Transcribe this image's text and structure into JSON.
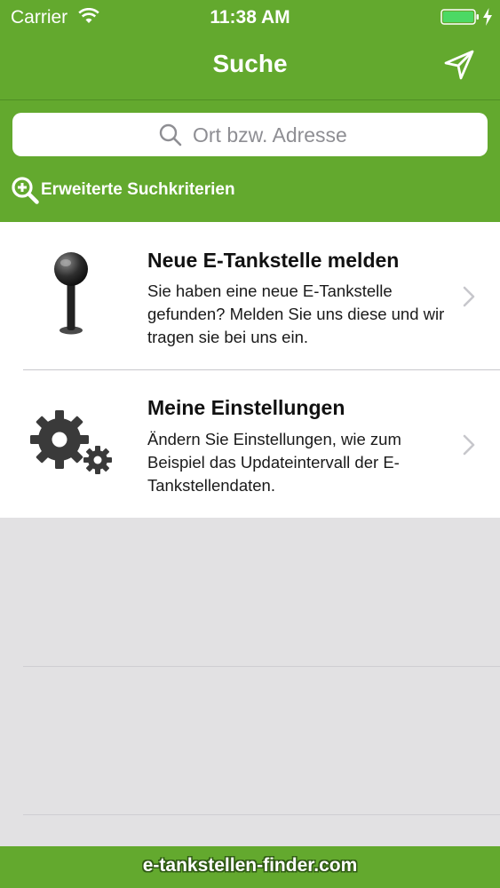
{
  "colors": {
    "brand_green": "#63a92e",
    "background": "#e2e1e3",
    "text_dark": "#111111",
    "placeholder_gray": "#8e8e93"
  },
  "status_bar": {
    "carrier": "Carrier",
    "time": "11:38 AM",
    "wifi_icon": "wifi-icon",
    "battery_icon": "battery-icon",
    "charging_icon": "bolt-icon"
  },
  "nav": {
    "title": "Suche",
    "location_icon": "location-arrow-icon"
  },
  "search": {
    "placeholder": "Ort bzw. Adresse",
    "icon": "search-icon"
  },
  "advanced_search": {
    "label": "Erweiterte Suchkriterien",
    "icon": "zoom-plus-icon"
  },
  "menu": [
    {
      "title": "Neue E-Tankstelle melden",
      "description": "Sie haben eine neue E-Tankstelle gefunden? Melden Sie uns diese und wir tragen sie bei uns ein.",
      "icon": "pin-icon"
    },
    {
      "title": "Meine Einstellungen",
      "description": "Ändern Sie Einstellungen, wie zum Beispiel das Updateintervall der E-Tankstellendaten.",
      "icon": "gears-icon"
    }
  ],
  "footer": {
    "text": "e-tankstellen-finder.com"
  }
}
